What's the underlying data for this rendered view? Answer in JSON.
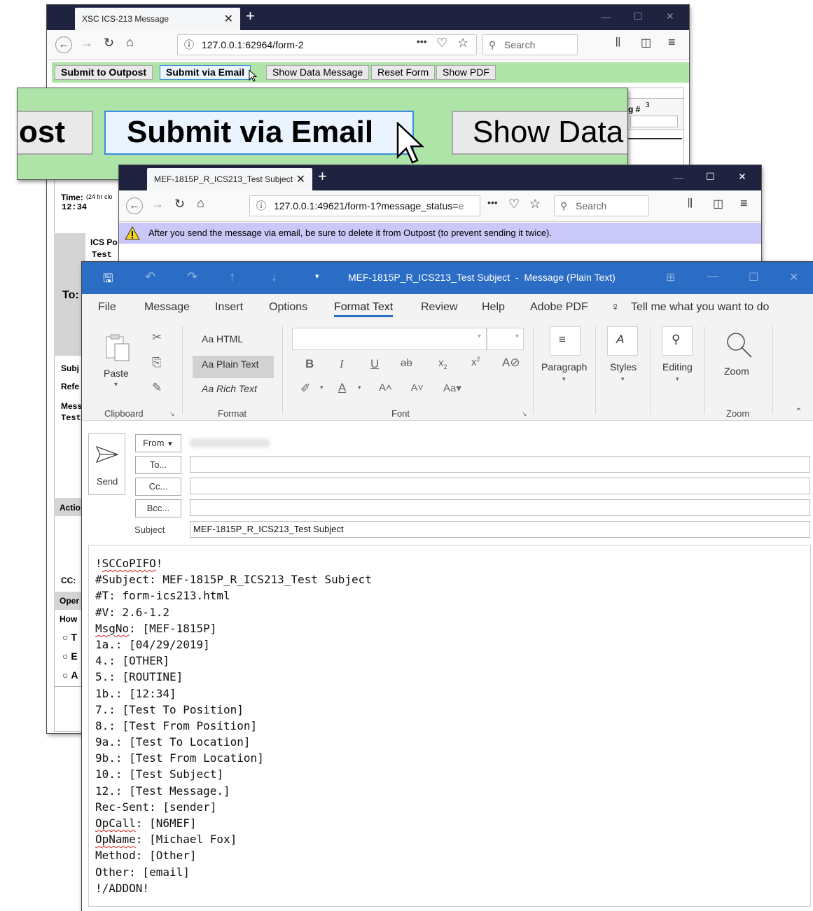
{
  "back_window": {
    "tab_title": "XSC ICS-213 Message",
    "url": "127.0.0.1:62964/form-2",
    "search_placeholder": "Search",
    "toolbar": {
      "submit_outpost": "Submit to Outpost",
      "submit_email": "Submit via Email",
      "show_data": "Show Data Message",
      "reset": "Reset Form",
      "show_pdf": "Show PDF"
    },
    "form": {
      "msg_num_label": "g #",
      "msg_num_sup": "3",
      "time_label": "Time:",
      "time_hint": "(24 hr clo",
      "time_value": "12:34",
      "ics_label": "ICS Po",
      "ics_value": "Test",
      "to_label": "To:",
      "subj_label": "Subj",
      "ref_label": "Refe",
      "mess_label": "Mess",
      "mess_value": "Test",
      "action_label": "Actio",
      "cc_label": "CC:",
      "oper_label": "Oper",
      "how_label": "How",
      "radio1": "T",
      "radio2": "E",
      "radio3": "A"
    }
  },
  "zoom_inset": {
    "btn_left": "ost",
    "btn_email": "Submit via Email",
    "btn_data": "Show Data"
  },
  "middle_window": {
    "tab_title": "MEF-1815P_R_ICS213_Test Subject",
    "url": "127.0.0.1:49621/form-1?message_status=",
    "url_tail": "e",
    "search_placeholder": "Search",
    "warning": "After you send the message via email, be sure to delete it from Outpost (to prevent sending it twice)."
  },
  "outlook": {
    "title": "MEF-1815P_R_ICS213_Test Subject  -  Message (Plain Text)",
    "menu": [
      "File",
      "Message",
      "Insert",
      "Options",
      "Format Text",
      "Review",
      "Help",
      "Adobe PDF"
    ],
    "tell_me": "Tell me what you want to do",
    "ribbon": {
      "paste": "Paste",
      "clipboard": "Clipboard",
      "fmt_html": "Aa HTML",
      "fmt_plain": "Aa Plain Text",
      "fmt_rich": "Aa Rich Text",
      "format": "Format",
      "font": "Font",
      "paragraph": "Paragraph",
      "styles": "Styles",
      "editing": "Editing",
      "zoom_btn": "Zoom",
      "zoom_group": "Zoom"
    },
    "send": "Send",
    "from": "From",
    "to": "To...",
    "cc": "Cc...",
    "bcc": "Bcc...",
    "subject_label": "Subject",
    "subject_value": "MEF-1815P_R_ICS213_Test Subject",
    "body": [
      "!SCCoPIFO!",
      "#Subject: MEF-1815P_R_ICS213_Test Subject",
      "#T: form-ics213.html",
      "#V: 2.6-1.2",
      "MsgNo: [MEF-1815P]",
      "1a.: [04/29/2019]",
      "4.: [OTHER]",
      "5.: [ROUTINE]",
      "1b.: [12:34]",
      "7.: [Test To Position]",
      "8.: [Test From Position]",
      "9a.: [Test To Location]",
      "9b.: [Test From Location]",
      "10.: [Test Subject]",
      "12.: [Test Message.]",
      "Rec-Sent: [sender]",
      "OpCall: [N6MEF]",
      "OpName: [Michael Fox]",
      "Method: [Other]",
      "Other: [email]",
      "!/ADDON!"
    ]
  }
}
